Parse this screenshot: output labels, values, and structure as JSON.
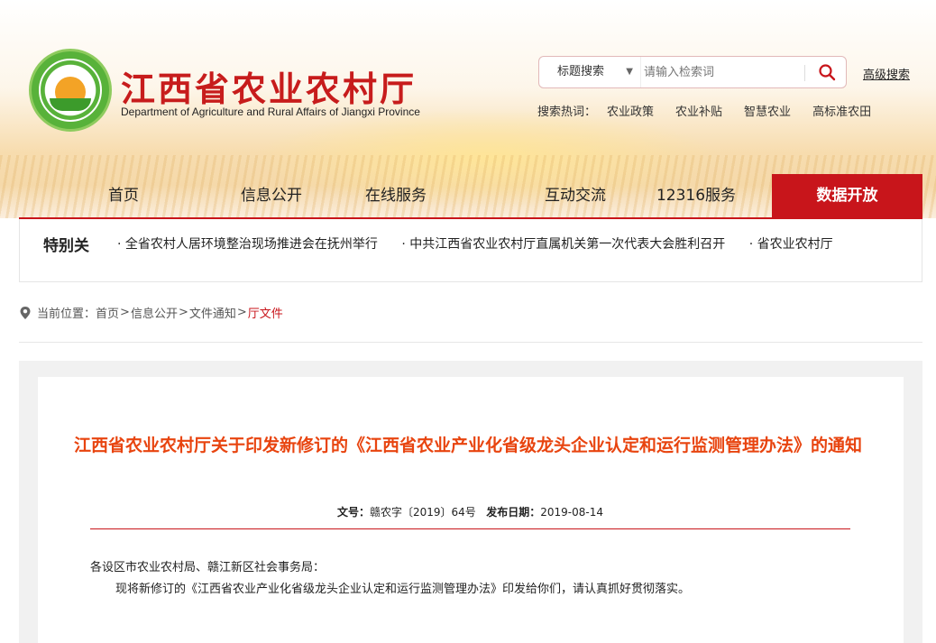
{
  "header": {
    "site_title": "江西省农业农村厅",
    "site_subtitle": "Department of Agriculture and Rural Affairs of Jiangxi Province",
    "search": {
      "type_label": "标题搜索",
      "placeholder": "请输入检索词",
      "advanced_label": "高级搜索"
    },
    "hotwords": {
      "label": "搜索热词：",
      "words": [
        "农业政策",
        "农业补贴",
        "智慧农业",
        "高标准农田"
      ]
    }
  },
  "nav": {
    "items": [
      "首页",
      "信息公开",
      "在线服务",
      "互动交流",
      "12316服务",
      "数据开放"
    ],
    "active_index": 5
  },
  "ticker": {
    "label": "特别关",
    "items": [
      "· 全省农村人居环境整治现场推进会在抚州举行",
      "· 中共江西省农业农村厅直属机关第一次代表大会胜利召开",
      "· 省农业农村厅"
    ]
  },
  "breadcrumb": {
    "prefix": "当前位置：",
    "items": [
      "首页",
      "信息公开",
      "文件通知"
    ],
    "current": "厅文件",
    "separator": ">"
  },
  "document": {
    "title": "江西省农业农村厅关于印发新修订的《江西省农业产业化省级龙头企业认定和运行监测管理办法》的通知",
    "doc_no_label": "文号：",
    "doc_no": "赣农字〔2019〕64号",
    "date_label": "发布日期：",
    "date": "2019-08-14",
    "addressee": "各设区市农业农村局、赣江新区社会事务局：",
    "paragraph1": "现将新修订的《江西省农业产业化省级龙头企业认定和运行监测管理办法》印发给你们，请认真抓好贯彻落实。"
  },
  "colors": {
    "brand_red": "#c8151b",
    "title_orange": "#e8440f",
    "logo_green": "#58b23a"
  }
}
